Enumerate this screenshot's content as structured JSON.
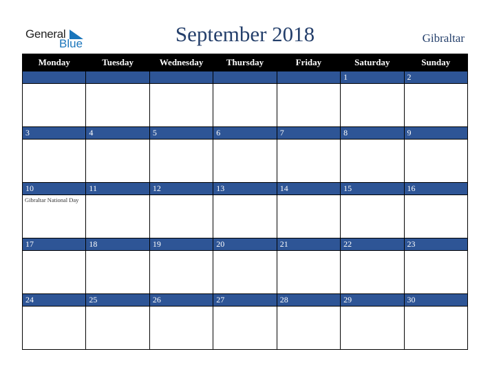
{
  "logo": {
    "line1": "General",
    "line2": "Blue"
  },
  "title": "September 2018",
  "country": "Gibraltar",
  "colors": {
    "header_bg": "#000000",
    "date_bar": "#2e5596",
    "title": "#243f6b",
    "logo_blue": "#1a75bb"
  },
  "days": [
    "Monday",
    "Tuesday",
    "Wednesday",
    "Thursday",
    "Friday",
    "Saturday",
    "Sunday"
  ],
  "weeks": [
    {
      "dates": [
        "",
        "",
        "",
        "",
        "",
        "1",
        "2"
      ],
      "events": [
        "",
        "",
        "",
        "",
        "",
        "",
        ""
      ]
    },
    {
      "dates": [
        "3",
        "4",
        "5",
        "6",
        "7",
        "8",
        "9"
      ],
      "events": [
        "",
        "",
        "",
        "",
        "",
        "",
        ""
      ]
    },
    {
      "dates": [
        "10",
        "11",
        "12",
        "13",
        "14",
        "15",
        "16"
      ],
      "events": [
        "Gibraltar National Day",
        "",
        "",
        "",
        "",
        "",
        ""
      ]
    },
    {
      "dates": [
        "17",
        "18",
        "19",
        "20",
        "21",
        "22",
        "23"
      ],
      "events": [
        "",
        "",
        "",
        "",
        "",
        "",
        ""
      ]
    },
    {
      "dates": [
        "24",
        "25",
        "26",
        "27",
        "28",
        "29",
        "30"
      ],
      "events": [
        "",
        "",
        "",
        "",
        "",
        "",
        ""
      ]
    }
  ]
}
